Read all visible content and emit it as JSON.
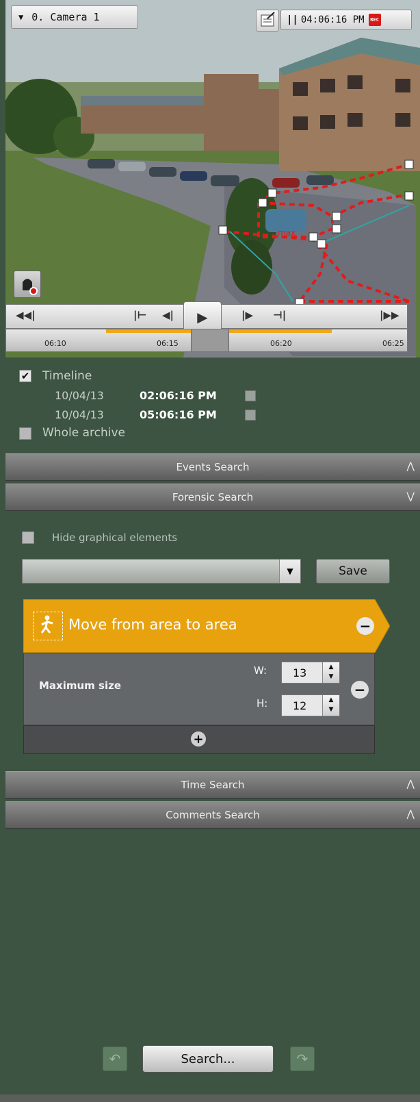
{
  "camera": {
    "selector_label": "0. Camera 1",
    "time": "04:06:16 PM",
    "rec_badge": "REC",
    "zone_label": "max"
  },
  "timeline_ticks": [
    "06:10",
    "06:15",
    "06:20",
    "06:25"
  ],
  "panel": {
    "timeline_label": "Timeline",
    "timeline_checked": true,
    "start": {
      "date": "10/04/13",
      "time": "02:06:16 PM"
    },
    "end": {
      "date": "10/04/13",
      "time": "05:06:16 PM"
    },
    "whole_archive_label": "Whole archive",
    "whole_archive_checked": false
  },
  "sections": {
    "events": "Events Search",
    "forensic": "Forensic Search",
    "time": "Time Search",
    "comments": "Comments Search"
  },
  "forensic": {
    "hide_graphical_label": "Hide graphical elements",
    "preset_value": "",
    "save_label": "Save",
    "condition_title": "Move from area to area",
    "filter_label": "Maximum size",
    "w_label": "W:",
    "w_value": "13",
    "h_label": "H:",
    "h_value": "12"
  },
  "footer": {
    "search_label": "Search..."
  },
  "colors": {
    "panel_bg": "#3c5441",
    "condition_orange": "#e7a20e",
    "zone_line": "#e21b1b"
  },
  "icons": [
    "dropdown-icon",
    "note-edit-icon",
    "pause-icon",
    "bell-record-icon",
    "skip-start-icon",
    "mark-in-icon",
    "frame-back-icon",
    "play-icon",
    "frame-forward-icon",
    "mark-out-icon",
    "skip-end-icon",
    "walking-person-icon",
    "minus-circle-icon",
    "plus-circle-icon",
    "undo-icon",
    "redo-icon",
    "chevron-double-up-icon",
    "chevron-double-down-icon"
  ]
}
